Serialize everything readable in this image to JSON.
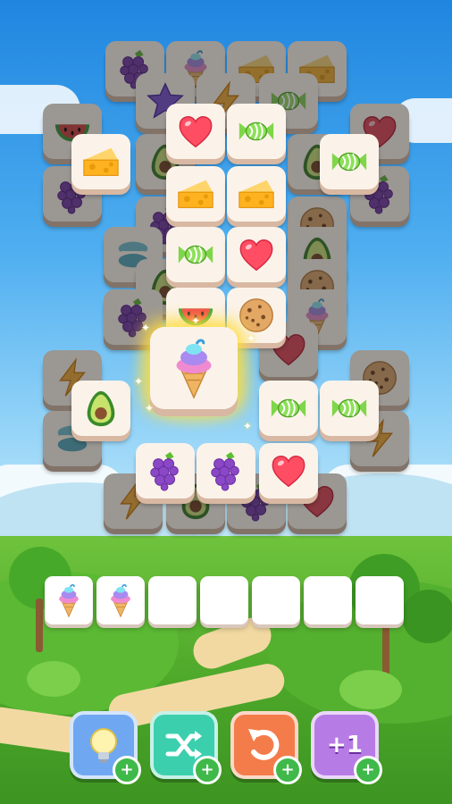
{
  "game": {
    "board": {
      "highlighted_tile": "ice-cream",
      "tile_types": [
        "grapes",
        "ice-cream",
        "cheese",
        "star",
        "lightning",
        "candy",
        "watermelon",
        "heart",
        "avocado",
        "macaron",
        "cookie"
      ]
    },
    "tray": {
      "capacity": 7,
      "filled": [
        "ice-cream",
        "ice-cream"
      ]
    },
    "powerups": [
      {
        "name": "hint",
        "icon": "lightbulb-icon",
        "color": "#6fa8f0"
      },
      {
        "name": "shuffle",
        "icon": "shuffle-icon",
        "color": "#3ccfae"
      },
      {
        "name": "undo",
        "icon": "undo-icon",
        "color": "#f47c4a"
      },
      {
        "name": "extra-slot",
        "icon": "plus-one-icon",
        "label": "+1",
        "color": "#b77be6"
      }
    ],
    "colors": {
      "accent_green": "#3fb94a",
      "tile_face": "#fbf3ea"
    }
  }
}
